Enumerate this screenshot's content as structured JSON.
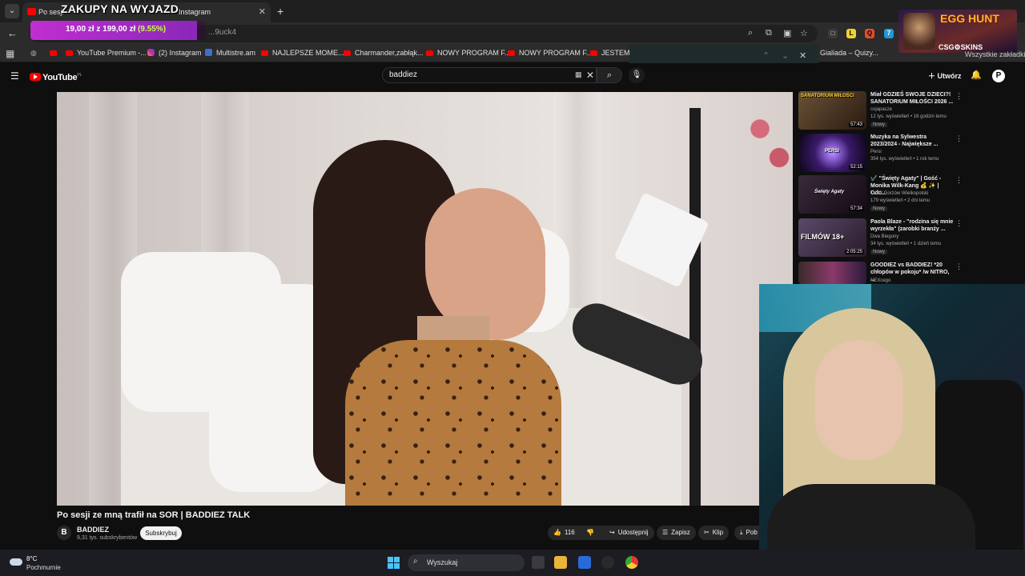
{
  "browser": {
    "tab_title": "Po sesji",
    "tab_title_suffix": "Instagram",
    "url": "...9uck4",
    "bookmarks": [
      {
        "label": "YouTube Premium -...",
        "icon": "youtube-icon"
      },
      {
        "label": "(2) Instagram",
        "icon": "instagram-icon"
      },
      {
        "label": "Multistre.am",
        "icon": "multistream-icon"
      },
      {
        "label": "NAJLEPSZE MOME...",
        "icon": "youtube-icon"
      },
      {
        "label": "Charmander,zabłąk...",
        "icon": "youtube-icon"
      },
      {
        "label": "NOWY PROGRAM F...",
        "icon": "youtube-icon"
      },
      {
        "label": "NOWY PROGRAM F...",
        "icon": "youtube-icon"
      },
      {
        "label": "JESTEM D",
        "icon": "youtube-icon"
      }
    ],
    "bookmark_right_a": "Gialiada – Quizy...",
    "bookmark_right_b": "Wszystkie zakładki"
  },
  "stream_overlay": {
    "title": "ZAKUPY NA WYJAZD",
    "goal_text": "19,00 zł",
    "goal_of": "z 199,00 zł",
    "goal_pct": "(9.55%)",
    "goal_fraction": 0.0955,
    "sponsor_title": "EGG HUNT",
    "sponsor_brand": "CSG⚙SKINS"
  },
  "youtube": {
    "logo_text": "YouTube",
    "logo_region": "PL",
    "search_value": "baddiez",
    "create_label": "Utwórz",
    "avatar_letter": "P",
    "video_title": "Po sesji ze mną trafił na SOR | BADDIEZ TALK",
    "channel_name": "BADDIEZ",
    "channel_subs": "9,31 tys. subskrybentów",
    "subscribe_label": "Subskrybuj",
    "actions": {
      "likes": "116",
      "share": "Udostępnij",
      "save": "Zapisz",
      "clip": "Klip",
      "download": "Pob"
    },
    "recommendations": [
      {
        "title": "Miał GDZIEŚ SWOJE DZIECI?! SANATORIUM MIŁOŚCI 2026 ...",
        "channel": "cojapacze",
        "meta": "12 tys. wyświetleń • 16 godzin temu",
        "badge": "Nowy",
        "duration": "57:43",
        "thumb_text": "SANATORIUM MIŁOŚCI",
        "thumb_color": "#7a5a3a"
      },
      {
        "title": "Muzyka na Sylwestra 2023/2024 - Największe ...",
        "channel": "Persi",
        "meta": "354 tys. wyświetleń • 1 rok temu",
        "badge": "",
        "duration": "52:15",
        "thumb_text": "PERSI",
        "thumb_color": "#3a1a6a"
      },
      {
        "title": "✔️ \"Święty Agaty\" | Gość - Monika Wilk-Kang 💰 ✨ | Odc...",
        "channel": "TVP3 Gorzów Wielkopolski",
        "meta": "179 wyświetleń • 2 dni temu",
        "badge": "Nowy",
        "duration": "57:34",
        "thumb_text": "Święty Agaty",
        "thumb_color": "#2a1a2a"
      },
      {
        "title": "Paola Blaze - \"rodzina się mnie wyrzekła\" (zarobki branży ...",
        "channel": "Dwa Bieguny",
        "meta": "34 tys. wyświetleń • 1 dzień temu",
        "badge": "Nowy",
        "duration": "2:05:25",
        "thumb_text": "FILMÓW 18+",
        "thumb_color": "#4a3a5a"
      },
      {
        "title": "GOODIEZ vs BADDIEZ! *20 chłopów w pokoju* /w NITRO, ...",
        "channel": "NEXcego",
        "meta": "",
        "badge": "",
        "duration": "",
        "thumb_text": "",
        "thumb_color": "#5a2a4a"
      }
    ]
  },
  "taskbar": {
    "temperature": "8°C",
    "weather": "Pochmurnie",
    "search_placeholder": "Wyszukaj"
  }
}
